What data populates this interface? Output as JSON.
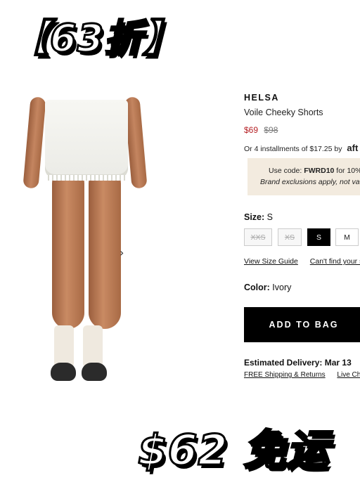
{
  "overlay": {
    "top_banner": "【63折】",
    "bottom_banner": "$62 免运"
  },
  "gallery": {
    "next_arrow": "›"
  },
  "product": {
    "brand": "HELSA",
    "name": "Voile Cheeky Shorts",
    "sale_price": "$69",
    "original_price": "$98",
    "installments": "Or 4 installments of $17.25 by",
    "installment_provider": "aft",
    "promo_line1_prefix": "Use code: ",
    "promo_code": "FWRD10",
    "promo_line1_suffix": " for 10%",
    "promo_line2": "Brand exclusions apply, not va",
    "size_label": "Size:",
    "size_value": "S",
    "sizes": [
      "XXS",
      "XS",
      "S",
      "M"
    ],
    "view_size_guide": "View Size Guide",
    "cant_find_size": "Can't find your s",
    "color_label": "Color:",
    "color_value": "Ivory",
    "add_to_bag": "ADD TO BAG",
    "estimated_delivery": "Estimated Delivery: Mar 13",
    "free_shipping": "FREE Shipping & Returns",
    "live_chat": "Live Ch"
  },
  "colors": {
    "sale": "#b51f24",
    "promo_bg": "#f3ebdf",
    "button_bg": "#000000"
  }
}
